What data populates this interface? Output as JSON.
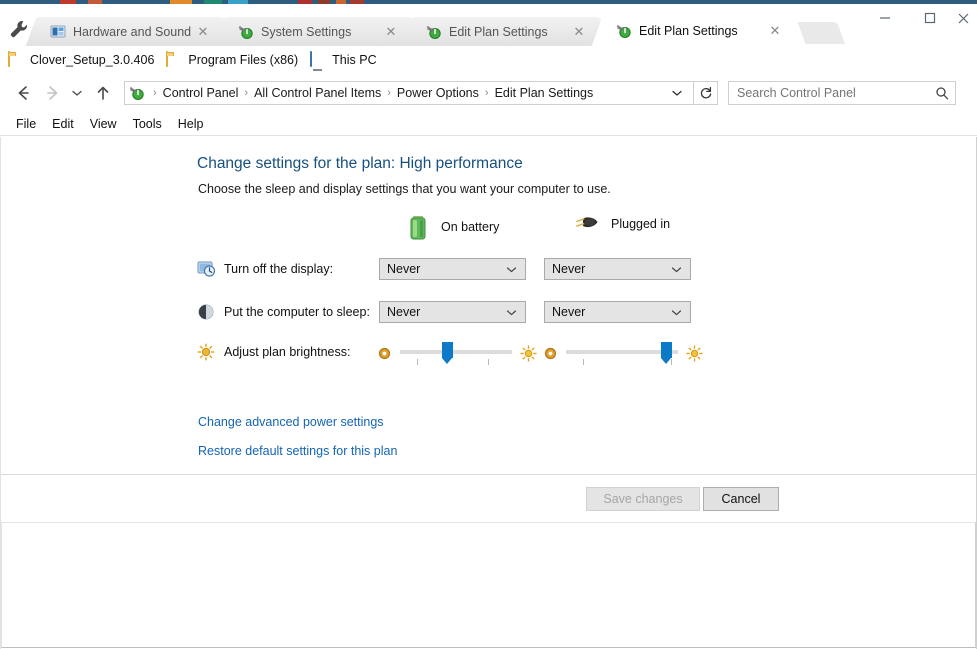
{
  "window": {
    "controls": {
      "minimize": "—",
      "maximize": "☐",
      "close": "✕"
    },
    "wrench_icon": "wrench-icon",
    "newtab_label": ""
  },
  "tabs": [
    {
      "title": "Hardware and Sound",
      "icon": "control-panel-icon",
      "close": "✕",
      "active": false
    },
    {
      "title": "System Settings",
      "icon": "power-options-icon",
      "close": "✕",
      "active": false
    },
    {
      "title": "Edit Plan Settings",
      "icon": "power-options-icon",
      "close": "✕",
      "active": false
    },
    {
      "title": "Edit Plan Settings",
      "icon": "power-options-icon",
      "close": "✕",
      "active": true
    }
  ],
  "favorites": [
    {
      "label": "Clover_Setup_3.0.406",
      "icon": "folder-icon"
    },
    {
      "label": "Program Files (x86)",
      "icon": "folder-icon"
    },
    {
      "label": "This PC",
      "icon": "computer-icon"
    }
  ],
  "nav": {
    "back": "←",
    "forward": "→",
    "recent": "⌄",
    "up": "↑",
    "refresh": "↻",
    "address_dropdown": "⌄",
    "breadcrumbs": [
      "Control Panel",
      "All Control Panel Items",
      "Power Options",
      "Edit Plan Settings"
    ],
    "separator": "›"
  },
  "search": {
    "placeholder": "Search Control Panel",
    "value": "",
    "icon": "search-icon"
  },
  "menubar": [
    "File",
    "Edit",
    "View",
    "Tools",
    "Help"
  ],
  "page": {
    "title": "Change settings for the plan: High performance",
    "subtitle": "Choose the sleep and display settings that you want your computer to use.",
    "columns": [
      {
        "label": "On battery",
        "icon": "battery-icon"
      },
      {
        "label": "Plugged in",
        "icon": "power-plug-icon"
      }
    ],
    "settings": [
      {
        "label": "Turn off the display:",
        "icon": "display-clock-icon",
        "battery_value": "Never",
        "plugged_value": "Never",
        "chevron": "⌄"
      },
      {
        "label": "Put the computer to sleep:",
        "icon": "sleep-moon-icon",
        "battery_value": "Never",
        "plugged_value": "Never",
        "chevron": "⌄"
      }
    ],
    "brightness": {
      "label": "Adjust plan brightness:",
      "icon": "brightness-icon",
      "dim_icon": "dim-icon",
      "bright_icon": "bright-icon",
      "battery_percent": 42,
      "plugged_percent": 94
    },
    "links": [
      "Change advanced power settings",
      "Restore default settings for this plan"
    ]
  },
  "footer": {
    "save_label": "Save changes",
    "save_disabled": true,
    "cancel_label": "Cancel"
  },
  "colors": {
    "title_blue": "#17507e",
    "link_blue": "#1464b4",
    "slider_blue": "#0d7ac8",
    "desktop_strip": "#2f5d82"
  }
}
